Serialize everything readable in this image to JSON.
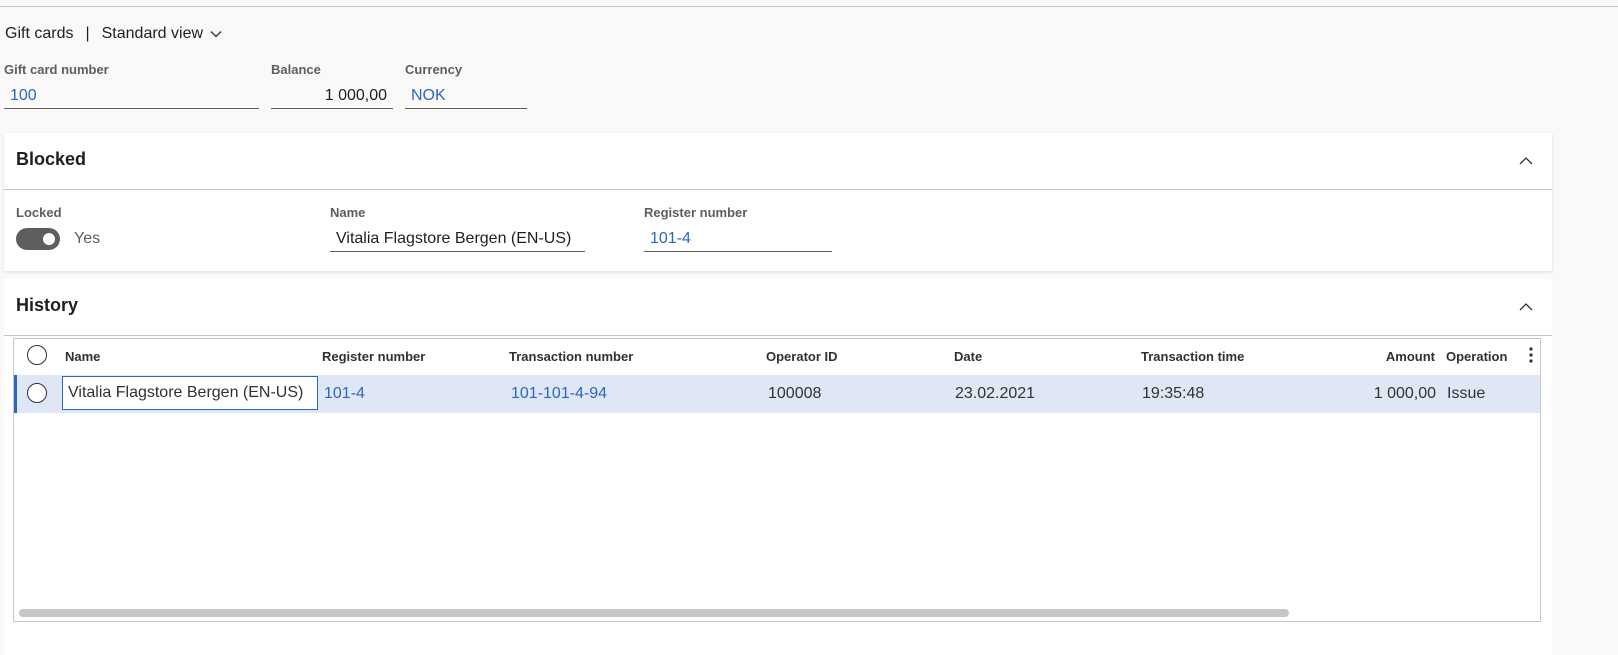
{
  "header": {
    "title": "Gift cards",
    "separator": "|",
    "view_label": "Standard view"
  },
  "summary": {
    "gift_card_number_label": "Gift card number",
    "gift_card_number": "100",
    "balance_label": "Balance",
    "balance": "1 000,00",
    "currency_label": "Currency",
    "currency": "NOK"
  },
  "blocked": {
    "title": "Blocked",
    "locked_label": "Locked",
    "locked_value": "Yes",
    "locked_on": true,
    "name_label": "Name",
    "name_value": "Vitalia Flagstore Bergen (EN-US)",
    "register_label": "Register number",
    "register_value": "101-4"
  },
  "history": {
    "title": "History",
    "columns": {
      "name": "Name",
      "register_number": "Register number",
      "transaction_number": "Transaction number",
      "operator_id": "Operator ID",
      "date": "Date",
      "transaction_time": "Transaction time",
      "amount": "Amount",
      "operation": "Operation"
    },
    "rows": [
      {
        "name": "Vitalia Flagstore Bergen (EN-US)",
        "register_number": "101-4",
        "transaction_number": "101-101-4-94",
        "operator_id": "100008",
        "date": "23.02.2021",
        "transaction_time": "19:35:48",
        "amount": "1 000,00",
        "operation": "Issue"
      }
    ]
  },
  "icons": {
    "view_dropdown": "chevron-down-icon",
    "collapse": "chevron-up-icon",
    "more": "more-vertical-icon"
  },
  "colors": {
    "link": "#2b66c2",
    "selected_row": "#dfe7f6",
    "toggle_on": "#605e5c",
    "background": "#faf9f8"
  }
}
